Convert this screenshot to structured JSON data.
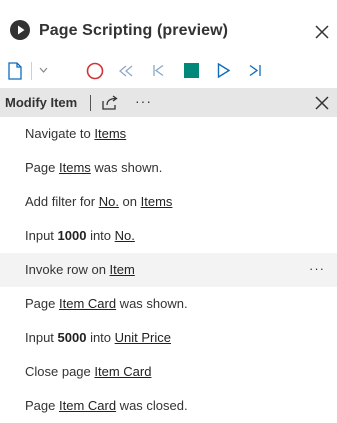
{
  "header": {
    "title": "Page Scripting (preview)"
  },
  "modify": {
    "label": "Modify Item",
    "more_label": "···"
  },
  "steps": [
    {
      "pre": "Navigate to ",
      "link": "Items",
      "post": ""
    },
    {
      "pre": "Page ",
      "link": "Items",
      "post": " was shown."
    },
    {
      "pre": "Add filter for ",
      "link": "No.",
      "mid": " on ",
      "link2": "Items"
    },
    {
      "pre": "Input ",
      "bold": "1000",
      "mid": " into ",
      "link": "No."
    },
    {
      "pre": "Invoke row on ",
      "link": "Item",
      "more": "···"
    },
    {
      "pre": "Page ",
      "link": "Item Card",
      "post": " was shown."
    },
    {
      "pre": "Input ",
      "bold": "5000",
      "mid": " into ",
      "link": "Unit Price"
    },
    {
      "pre": "Close page ",
      "link": "Item Card"
    },
    {
      "pre": "Page ",
      "link": "Item Card",
      "post": " was closed."
    }
  ],
  "colors": {
    "record": "#d13438",
    "stop": "#00897b",
    "play": "#0f6cbd",
    "toolbar_icon": "#0f6cbd"
  },
  "icons": [
    "play-circle-icon",
    "close-icon",
    "new-file-icon",
    "chevron-down-icon",
    "record-icon",
    "rewind-icon",
    "step-back-icon",
    "stop-icon",
    "play-icon",
    "step-forward-icon",
    "share-icon",
    "more-icon"
  ]
}
